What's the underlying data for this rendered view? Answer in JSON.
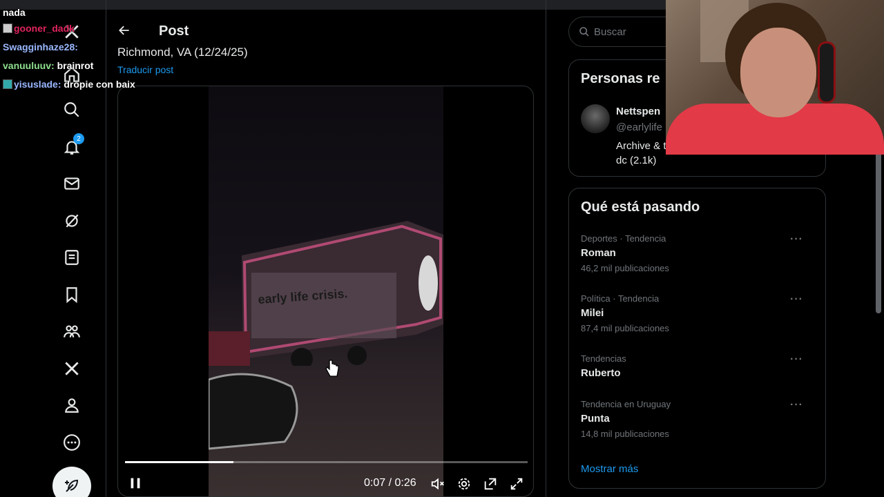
{
  "colors": {
    "accent": "#1d9bf0",
    "background": "#000000",
    "border": "#2f3336",
    "muted": "#71767b"
  },
  "chat": [
    {
      "user": "",
      "message": "nada",
      "user_color": "#ffffff"
    },
    {
      "user": "gooner_dadk",
      "message": "",
      "user_color": "#e0245e"
    },
    {
      "user": "Swagginhaze28:",
      "message": "",
      "user_color": "#9ab7ff"
    },
    {
      "user": "vanuuluuv:",
      "message": "brainrot",
      "user_color": "#8fe08f"
    },
    {
      "user": "yisuslade:",
      "message": "dropie con baix",
      "user_color": "#9ab7ff"
    }
  ],
  "nav": {
    "items": [
      {
        "icon": "x-logo-icon"
      },
      {
        "icon": "home-icon"
      },
      {
        "icon": "search-icon"
      },
      {
        "icon": "bell-icon",
        "badge": "2"
      },
      {
        "icon": "mail-icon"
      },
      {
        "icon": "grok-icon"
      },
      {
        "icon": "lists-icon"
      },
      {
        "icon": "bookmark-icon"
      },
      {
        "icon": "communities-icon"
      },
      {
        "icon": "x-premium-icon"
      },
      {
        "icon": "profile-icon"
      },
      {
        "icon": "more-icon"
      }
    ],
    "notifications_badge": "2"
  },
  "post": {
    "header_title": "Post",
    "location_text": "Richmond, VA (12/24/25)",
    "translate_link": "Traducir post",
    "video": {
      "current_time": "0:07",
      "duration": "0:26",
      "time_display": "0:07 / 0:26",
      "progress": 0.27,
      "truck_text": "early life crisis."
    }
  },
  "search": {
    "placeholder": "Buscar"
  },
  "who_to_follow": {
    "title": "Personas re",
    "person": {
      "name": "Nettspen",
      "handle": "@earlylife",
      "bio": "Archive & the dc (2.1k)"
    }
  },
  "trends": {
    "title": "Qué está pasando",
    "items": [
      {
        "category": "Deportes · Tendencia",
        "name": "Roman",
        "count": "46,2 mil publicaciones"
      },
      {
        "category": "Política · Tendencia",
        "name": "Milei",
        "count": "87,4 mil publicaciones"
      },
      {
        "category": "Tendencias",
        "name": "Ruberto",
        "count": ""
      },
      {
        "category": "Tendencia en Uruguay",
        "name": "Punta",
        "count": "14,8 mil publicaciones"
      }
    ],
    "show_more": "Mostrar más"
  }
}
